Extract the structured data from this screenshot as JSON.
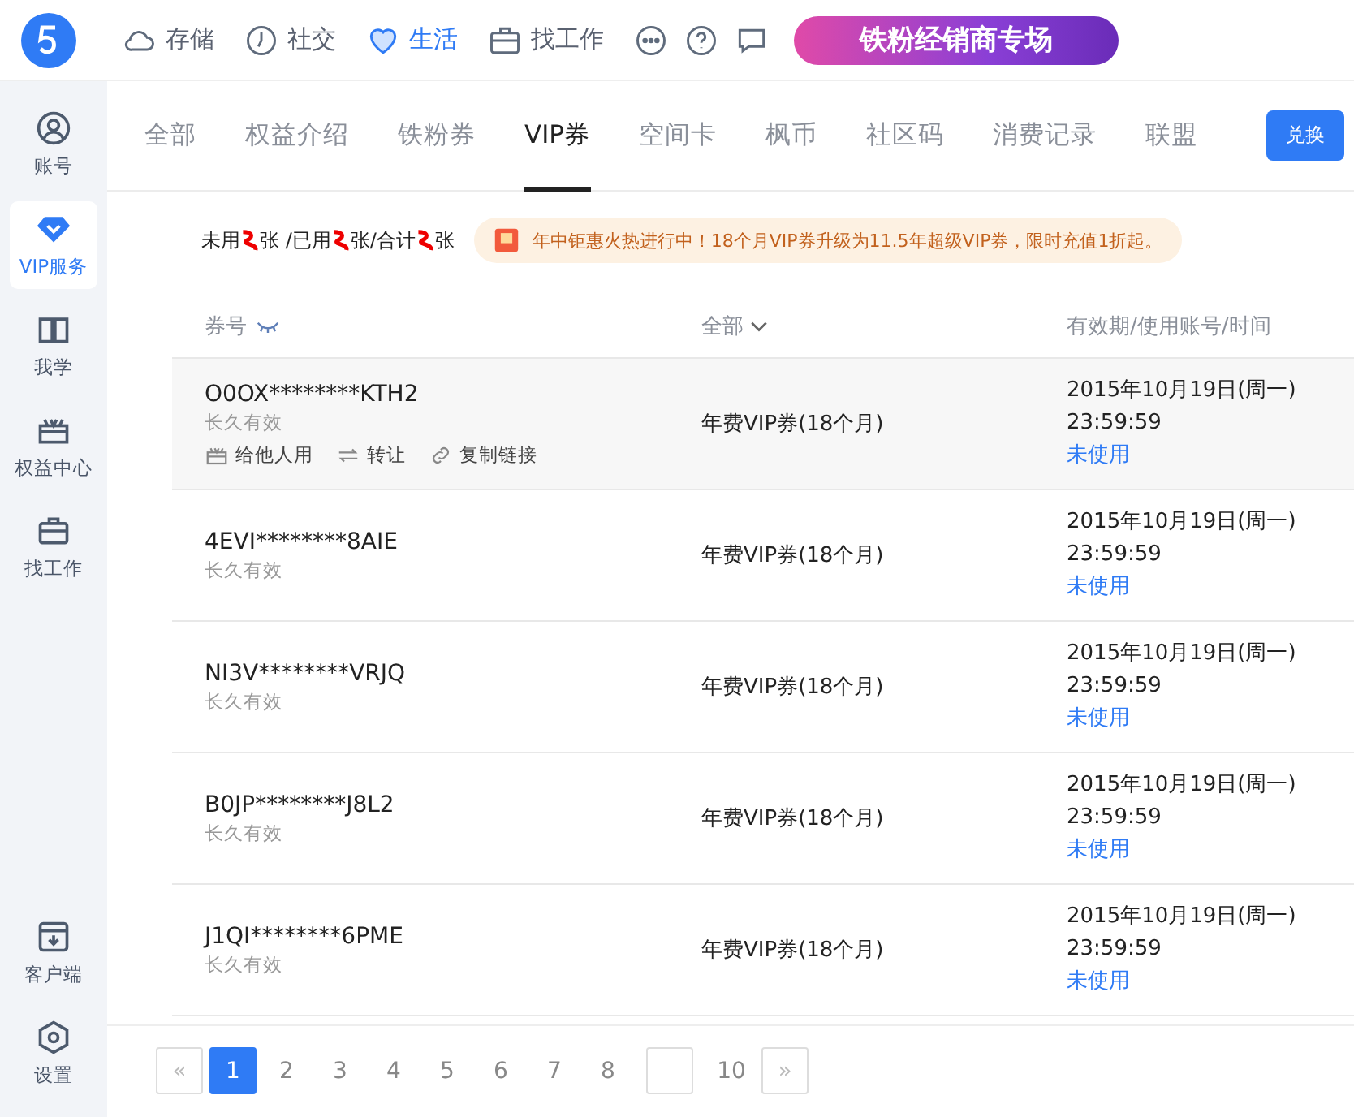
{
  "top_nav": {
    "items": [
      {
        "label": "存储",
        "selected": false
      },
      {
        "label": "社交",
        "selected": false
      },
      {
        "label": "生活",
        "selected": true
      },
      {
        "label": "找工作",
        "selected": false
      }
    ],
    "banner": "铁粉经销商专场"
  },
  "sidebar": {
    "items": [
      {
        "label": "账号",
        "selected": false
      },
      {
        "label": "VIP服务",
        "selected": true
      },
      {
        "label": "我学",
        "selected": false
      },
      {
        "label": "权益中心",
        "selected": false
      },
      {
        "label": "找工作",
        "selected": false
      }
    ],
    "bottom_items": [
      {
        "label": "客户端"
      },
      {
        "label": "设置"
      }
    ]
  },
  "tabs": [
    {
      "label": "全部",
      "selected": false
    },
    {
      "label": "权益介绍",
      "selected": false
    },
    {
      "label": "铁粉券",
      "selected": false
    },
    {
      "label": "VIP券",
      "selected": true
    },
    {
      "label": "空间卡",
      "selected": false
    },
    {
      "label": "枫币",
      "selected": false
    },
    {
      "label": "社区码",
      "selected": false
    },
    {
      "label": "消费记录",
      "selected": false
    },
    {
      "label": "联盟",
      "selected": false
    }
  ],
  "redeem_button": "兑换",
  "summary": [
    "未用",
    "张 /已用",
    "张/合计",
    "张"
  ],
  "promo": "年中钜惠火热进行中！18个月VIP券升级为11.5年超级VIP券，限时充值1折起。",
  "table": {
    "columns": [
      "券号",
      "全部",
      "有效期/使用账号/时间"
    ],
    "rows": [
      {
        "code": "O0OX********KTH2",
        "validity": "长久有效",
        "type": "年费VIP券(18个月)",
        "date": "2015年10月19日(周一)",
        "time": "23:59:59",
        "status": "未使用",
        "actions": [
          {
            "label": "给他人用"
          },
          {
            "label": "转让"
          },
          {
            "label": "复制链接"
          }
        ]
      },
      {
        "code": "4EVI********8AIE",
        "validity": "长久有效",
        "type": "年费VIP券(18个月)",
        "date": "2015年10月19日(周一)",
        "time": "23:59:59",
        "status": "未使用"
      },
      {
        "code": "NI3V********VRJQ",
        "validity": "长久有效",
        "type": "年费VIP券(18个月)",
        "date": "2015年10月19日(周一)",
        "time": "23:59:59",
        "status": "未使用"
      },
      {
        "code": "B0JP********J8L2",
        "validity": "长久有效",
        "type": "年费VIP券(18个月)",
        "date": "2015年10月19日(周一)",
        "time": "23:59:59",
        "status": "未使用"
      },
      {
        "code": "J1QI********6PME",
        "validity": "长久有效",
        "type": "年费VIP券(18个月)",
        "date": "2015年10月19日(周一)",
        "time": "23:59:59",
        "status": "未使用"
      }
    ]
  },
  "pagination": {
    "prev": "«",
    "next": "»",
    "pages": [
      {
        "label": "1",
        "selected": true
      },
      {
        "label": "2",
        "selected": false
      },
      {
        "label": "3",
        "selected": false
      },
      {
        "label": "4",
        "selected": false
      },
      {
        "label": "5",
        "selected": false
      },
      {
        "label": "6",
        "selected": false
      },
      {
        "label": "7",
        "selected": false
      },
      {
        "label": "8",
        "selected": false
      },
      {
        "kind": "input"
      },
      {
        "label": "10",
        "selected": false
      }
    ]
  }
}
